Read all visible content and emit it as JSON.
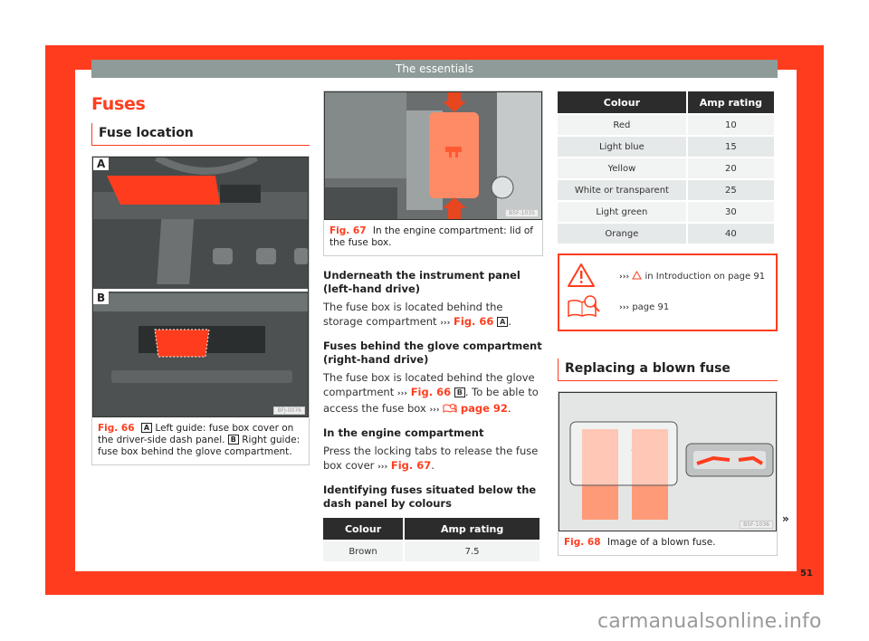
{
  "header": {
    "title": "The essentials"
  },
  "section": {
    "title": "Fuses",
    "subtitle": "Fuse location"
  },
  "fig66": {
    "photo_label_a": "A",
    "photo_label_b": "B",
    "code": "BFJ-0076",
    "label": "Fig. 66",
    "caption_a_letter": "A",
    "caption_a": " Left guide: fuse box cover on the driver-side dash panel. ",
    "caption_b_letter": "B",
    "caption_b": " Right guide: fuse box behind the glove compartment."
  },
  "fig67": {
    "code": "B5F-1035",
    "label": "Fig. 67",
    "caption": "In the engine compartment: lid of the fuse box."
  },
  "content": {
    "sub1": "Underneath the instrument panel (left-hand drive)",
    "para1_text": "The fuse box is located behind the storage compartment ",
    "para1_arrows": "›››",
    "para1_link": "Fig. 66",
    "para1_letter": "A",
    "sub2": "Fuses behind the glove compartment (right-hand drive)",
    "para2_text": "The fuse box is located behind the glove compartment ",
    "para2_arrows": "›››",
    "para2_link": "Fig. 66",
    "para2_letter": "B",
    "para2_text2": ". To be able to access the fuse box ",
    "para2_arrows2": "›››",
    "para2_link2": "page 92",
    "sub3": "In the engine compartment",
    "para3_text": "Press the locking tabs to release the fuse box cover ",
    "para3_arrows": "›››",
    "para3_link": "Fig. 67",
    "sub4": "Identifying fuses situated below the dash panel by colours"
  },
  "table_small": {
    "headers": [
      "Colour",
      "Amp rating"
    ],
    "rows": [
      [
        "Brown",
        "7.5"
      ]
    ]
  },
  "table_main": {
    "headers": [
      "Colour",
      "Amp rating"
    ],
    "rows": [
      [
        "Red",
        "10"
      ],
      [
        "Light blue",
        "15"
      ],
      [
        "Yellow",
        "20"
      ],
      [
        "White or transparent",
        "25"
      ],
      [
        "Light green",
        "30"
      ],
      [
        "Orange",
        "40"
      ]
    ]
  },
  "warnings": {
    "row1_arrows": "›››",
    "row1_text": " in Introduction on page 91",
    "row2_arrows": "›››",
    "row2_text": " page 91"
  },
  "replacing": {
    "title": "Replacing a blown fuse"
  },
  "fig68": {
    "code": "B5F-1036",
    "label": "Fig. 68",
    "caption": "Image of a blown fuse."
  },
  "continue_marker": "»",
  "page_number": "51",
  "watermark": "carmanualsonline.info",
  "colors": {
    "accent": "#ff3d1e",
    "header_bar": "#8e9b98",
    "table_header": "#2c2c2c"
  }
}
